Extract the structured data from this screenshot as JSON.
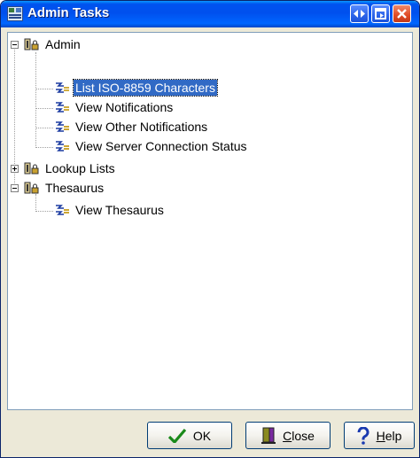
{
  "window": {
    "title": "Admin Tasks"
  },
  "tree": {
    "items": [
      {
        "label": "Admin",
        "expanded": true
      },
      {
        "label": "List ISO-8859 Characters",
        "selected": true
      },
      {
        "label": "View Notifications"
      },
      {
        "label": "View Other Notifications"
      },
      {
        "label": "View Server Connection Status"
      },
      {
        "label": "Lookup Lists",
        "expanded": false
      },
      {
        "label": "Thesaurus",
        "expanded": true
      },
      {
        "label": "View Thesaurus"
      }
    ]
  },
  "buttons": {
    "ok": {
      "label": "OK",
      "icon": "checkmark-icon"
    },
    "close": {
      "prefix": "",
      "underline": "C",
      "rest": "lose",
      "icon": "door-icon"
    },
    "help": {
      "prefix": "",
      "underline": "H",
      "rest": "elp",
      "icon": "question-icon"
    }
  },
  "colors": {
    "title_bar": "#0053ee",
    "selection": "#316ac5",
    "window_bg": "#ece9d8",
    "close_button": "#e04a23"
  }
}
